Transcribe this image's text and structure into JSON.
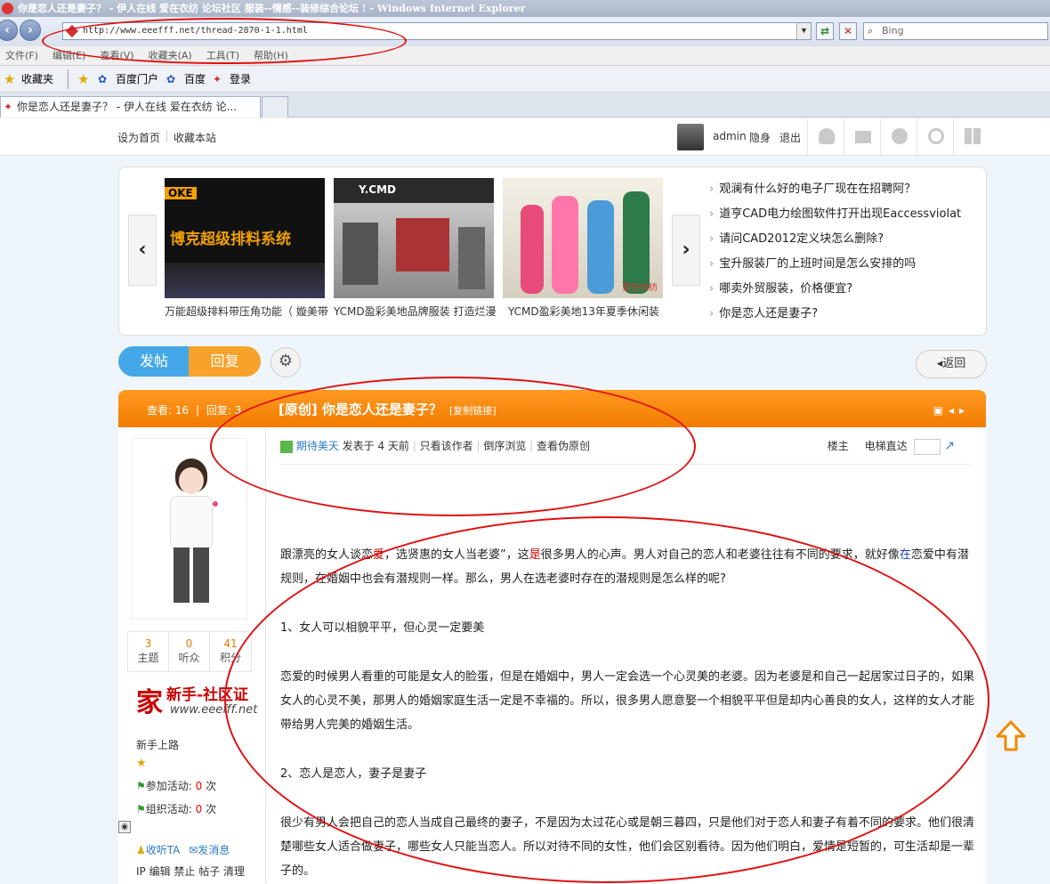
{
  "window": {
    "title": "你是恋人还是妻子？ - 伊人在线 爱在衣纺 论坛社区 服装--情感--装修综合论坛 ! - Windows Internet Explorer"
  },
  "address": {
    "url": "http://www.eeefff.net/thread-2870-1-1.html",
    "search_placeholder": "Bing"
  },
  "menu": [
    "文件(F)",
    "编辑(E)",
    "查看(V)",
    "收藏夹(A)",
    "工具(T)",
    "帮助(H)"
  ],
  "favbar": {
    "favorites": "收藏夹",
    "items": [
      "百度门户",
      "百度",
      "登录"
    ]
  },
  "tab": {
    "title": "你是恋人还是妻子？ - 伊人在线 爱在衣纺 论..."
  },
  "topbar": {
    "set_home": "设为首页",
    "bookmark": "收藏本站",
    "username": "admin",
    "invisible": "隐身",
    "logout": "退出"
  },
  "slider": {
    "captions": [
      "万能超级排料带压角功能（ 嫙美带",
      "YCMD盈彩美地品牌服装 打造烂漫",
      "YCMD盈彩美地13年夏季休闲装"
    ],
    "img1_text_top": "OKE",
    "img1_text_main": "博克超级排料系统",
    "img2_text": "Y.CMD",
    "img3_text": "爱在衣纺",
    "news": [
      "观澜有什么好的电子厂现在在招聘阿？",
      "道亨CAD电力绘图软件打开出现Eaccessviolat",
      "请问CAD2012定义块怎么删除?",
      "宝升服装厂的上班时间是怎么安排的吗",
      "哪卖外贸服装，价格便宜?",
      "你是恋人还是妻子?"
    ]
  },
  "actions": {
    "post": "发帖",
    "reply": "回复",
    "back": "返回"
  },
  "thread": {
    "views_label": "查看:",
    "views": "16",
    "replies_label": "回复:",
    "replies": "3",
    "title": "[原创] 你是恋人还是妻子？",
    "copy_link": "[复制链接]",
    "author": "期待美天",
    "posted": "发表于 4 天前",
    "only_author": "只看该作者",
    "reverse": "倒序浏览",
    "view_pseudo": "查看伪原创",
    "floor": "楼主",
    "elevator": "电梯直达"
  },
  "user": {
    "stats": [
      {
        "n": "3",
        "label": "主题"
      },
      {
        "n": "0",
        "label": "听众"
      },
      {
        "n": "41",
        "label": "积分"
      }
    ],
    "medal_text": "新手-社区证",
    "medal_url": "www.eeefff.net",
    "rank": "新手上路",
    "activity_join": "参加活动:",
    "activity_join_n": "0",
    "activity_org": "组织活动:",
    "activity_org_n": "0",
    "times": "次",
    "follow": "收听TA",
    "message": "发消息",
    "admin_links": "IP 编辑 禁止 帖子 清理"
  },
  "post": {
    "p1a": "跟漂亮的女人谈恋",
    "p1b": "爱",
    "p1c": "，选贤惠的女人当老婆”，这",
    "p1d": "是",
    "p1e": "很多男人的心声。男人对自己的恋人和老婆往往有不同的要求，就好像",
    "p1f": "在",
    "p1g": "恋爱中有潜规则，在婚姻中也会有潜规则一样。那么，男人在选老婆时存在的潜规则是怎么样的呢?",
    "h1": "1、女人可以相貌平平，但心灵一定要美",
    "p2": "恋爱的时候男人看重的可能是女人的脸蛋，但是在婚姻中，男人一定会选一个心灵美的老婆。因为老婆是和自己一起居家过日子的，如果女人的心灵不美，那男人的婚姻家庭生活一定是不幸福的。所以，很多男人愿意娶一个相貌平平但是却内心善良的女人，这样的女人才能带给男人完美的婚姻生活。",
    "h2": "2、恋人是恋人，妻子是妻子",
    "p3": "很少有男人会把自己的恋人当成自己最终的妻子，不是因为太过花心或是朝三暮四，只是他们对于恋人和妻子有着不同的要求。他们很清楚哪些女人适合做妻子，哪些女人只能当恋人。所以对待不同的女性，他们会区别看待。因为他们明白，爱情是短暂的，可生活却是一辈子的。"
  },
  "colors": {
    "orange": "#f27b00",
    "blue": "#44a8e8",
    "annotation_red": "#e01010"
  }
}
